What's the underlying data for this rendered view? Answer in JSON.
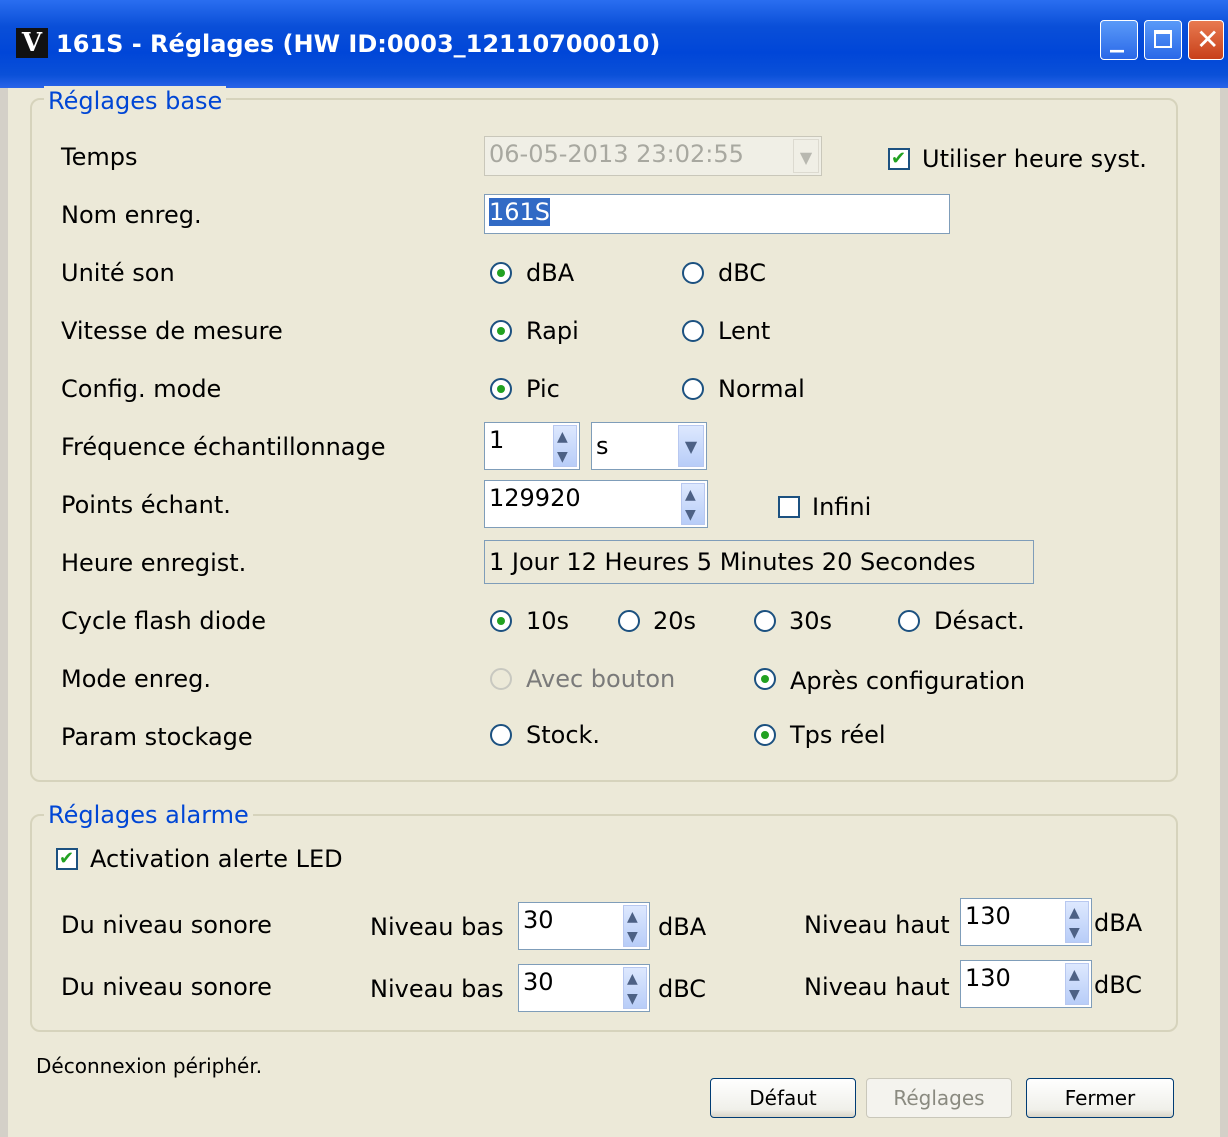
{
  "window": {
    "title": "161S - Réglages (HW ID:0003_12110700010)",
    "icon_glyph": "V",
    "controls": {
      "minimize": "minimize-icon",
      "maximize": "maximize-icon",
      "close": "close-icon"
    }
  },
  "base": {
    "legend": "Réglages base",
    "temps": {
      "label": "Temps",
      "value": "06-05-2013 23:02:55",
      "use_system_label": "Utiliser heure syst.",
      "use_system": true
    },
    "nom": {
      "label": "Nom enreg.",
      "value": "161S"
    },
    "unite": {
      "label": "Unité son",
      "opt1": "dBA",
      "opt2": "dBC",
      "selected": "dBA"
    },
    "vitesse": {
      "label": "Vitesse de mesure",
      "opt1": "Rapi",
      "opt2": "Lent",
      "selected": "Rapi"
    },
    "config": {
      "label": "Config. mode",
      "opt1": "Pic",
      "opt2": "Normal",
      "selected": "Pic"
    },
    "frequence": {
      "label": "Fréquence échantillonnage",
      "value": "1",
      "unit": "s"
    },
    "points": {
      "label": "Points échant.",
      "value": "129920",
      "infini_label": "Infini",
      "infini": false
    },
    "heure": {
      "label": "Heure enregist.",
      "value": "1 Jour 12 Heures 5 Minutes 20 Secondes"
    },
    "cycle": {
      "label": "Cycle flash diode",
      "opt1": "10s",
      "opt2": "20s",
      "opt3": "30s",
      "opt4": "Désact.",
      "selected": "10s"
    },
    "mode": {
      "label": "Mode enreg.",
      "opt1": "Avec bouton",
      "opt2": "Après configuration",
      "selected": "Après configuration"
    },
    "stockage": {
      "label": "Param stockage",
      "opt1": "Stock.",
      "opt2": "Tps réel",
      "selected": "Tps réel"
    }
  },
  "alarm": {
    "legend": "Réglages alarme",
    "led_label": "Activation alerte LED",
    "led_enabled": true,
    "rows": [
      {
        "label": "Du niveau sonore",
        "low_label": "Niveau bas",
        "low_value": "30",
        "low_unit": "dBA",
        "high_label": "Niveau haut",
        "high_value": "130",
        "high_unit": "dBA"
      },
      {
        "label": "Du niveau sonore",
        "low_label": "Niveau bas",
        "low_value": "30",
        "low_unit": "dBC",
        "high_label": "Niveau haut",
        "high_value": "130",
        "high_unit": "dBC"
      }
    ]
  },
  "footer": {
    "status": "Déconnexion périphér.",
    "default_label": "Défaut",
    "settings_label": "Réglages",
    "close_label": "Fermer"
  }
}
